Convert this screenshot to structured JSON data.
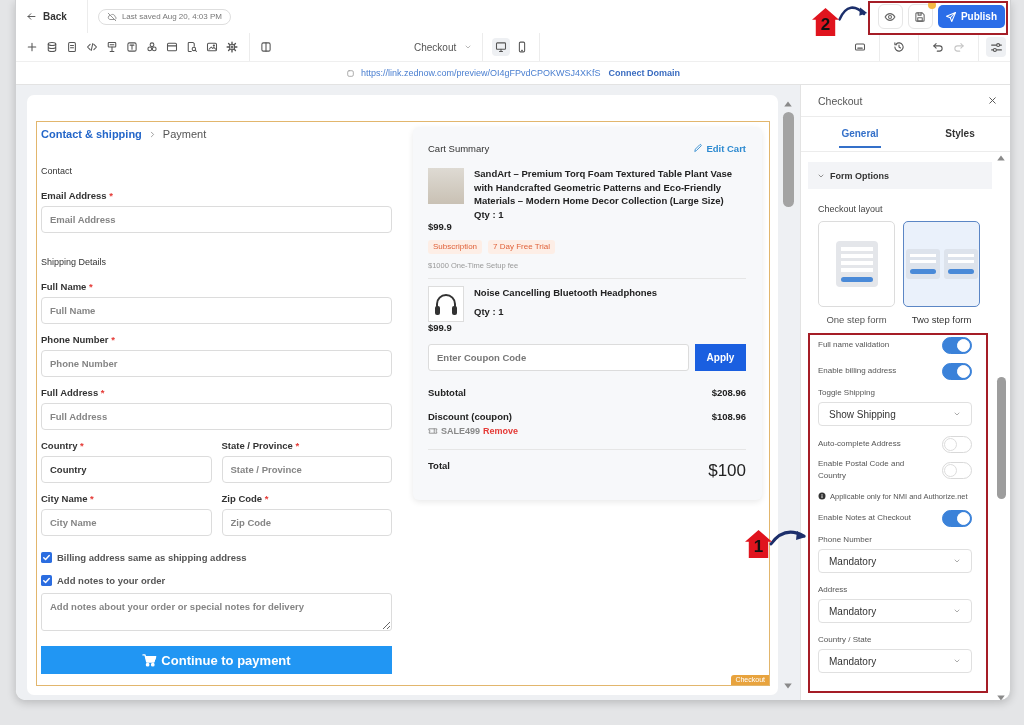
{
  "topbar": {
    "back": "Back",
    "last_saved": "Last saved Aug 20, 4:03 PM",
    "unsaved": true,
    "publish": "Publish"
  },
  "toolbar": {
    "page": "Checkout",
    "devices": [
      {
        "kind": "desktop",
        "selected": true
      },
      {
        "kind": "mobile",
        "selected": false
      }
    ],
    "history": [
      {
        "kind": "undo",
        "disabled": false
      },
      {
        "kind": "redo",
        "disabled": true
      }
    ]
  },
  "url_bar": {
    "url": "https://link.zednow.com/preview/OI4gFPvdCPOKWSJ4XKfS",
    "link": "Connect Domain"
  },
  "checkout_form": {
    "breadcrumb": [
      {
        "label": "Contact & shipping",
        "selected": true
      },
      {
        "label": "Payment",
        "selected": false
      }
    ],
    "sections": [
      {
        "heading": "Contact",
        "rows": [
          [
            {
              "label": "Email Address",
              "mark": "*",
              "placeholder": "Email Address"
            }
          ]
        ]
      },
      {
        "heading": "Shipping Details",
        "rows": [
          [
            {
              "label": "Full Name",
              "mark": "*",
              "placeholder": "Full Name"
            }
          ],
          [
            {
              "label": "Phone Number",
              "mark": "*",
              "placeholder": "Phone Number"
            }
          ],
          [
            {
              "label": "Full Address",
              "mark": "*",
              "placeholder": "Full Address"
            }
          ],
          [
            {
              "label": "Country",
              "mark": "*",
              "value": "Country"
            },
            {
              "label": "State / Province",
              "mark": "*",
              "placeholder": "State / Province"
            }
          ],
          [
            {
              "label": "City Name",
              "mark": "*",
              "placeholder": "City Name"
            },
            {
              "label": "Zip Code",
              "mark": "*",
              "placeholder": "Zip Code"
            }
          ]
        ]
      }
    ],
    "checkboxes": [
      {
        "label": "Billing address same as shipping address",
        "checked": true
      },
      {
        "label": "Add notes to your order",
        "checked": true
      }
    ],
    "notes": {
      "placeholder": "Add notes about your order or special notes for delivery"
    },
    "submit": "Continue to payment",
    "tag": "Checkout"
  },
  "cart_summary": {
    "title": "Cart Summary",
    "edit": "Edit Cart",
    "items": [
      {
        "kind": "photo",
        "name": "SandArt – Premium Torq Foam Textured Table Plant Vase with Handcrafted Geometric Patterns and Eco-Friendly Materials – Modern Home Decor Collection (Large Size)",
        "qty": "Qty : 1",
        "price": "$99.9",
        "tags": [
          "Subscription",
          "7 Day Free Trial"
        ],
        "note": "$1000 One-Time Setup fee"
      },
      {
        "kind": "headphones",
        "name": "Noise Cancelling Bluetooth Headphones",
        "qty": "Qty : 1",
        "price": "$99.9"
      }
    ],
    "coupon": {
      "placeholder": "Enter Coupon Code",
      "button": "Apply"
    },
    "totals": [
      {
        "label": "Subtotal",
        "value": "$208.96"
      },
      {
        "label": "Discount (coupon)",
        "value": "$108.96",
        "code": "SALE499",
        "action": "Remove"
      }
    ],
    "total": {
      "label": "Total",
      "value": "$100"
    }
  },
  "settings_panel": {
    "title": "Checkout",
    "tabs": [
      {
        "label": "General",
        "selected": true
      },
      {
        "label": "Styles",
        "selected": false
      }
    ],
    "section": {
      "title": "Form Options",
      "expanded": true
    },
    "layout": {
      "label": "Checkout layout",
      "options": [
        {
          "kind": "one-step",
          "label": "One step form",
          "selected": false
        },
        {
          "kind": "two-step",
          "label": "Two step form",
          "selected": true
        }
      ]
    },
    "options": [
      {
        "kind": "toggle",
        "label": "Full name validation",
        "on": true
      },
      {
        "kind": "toggle",
        "label": "Enable billing address",
        "on": true
      },
      {
        "kind": "select",
        "label": "Toggle Shipping",
        "value": "Show Shipping"
      },
      {
        "kind": "toggle",
        "label": "Auto-complete Address",
        "on": false
      },
      {
        "kind": "toggle",
        "label": "Enable Postal Code and Country",
        "on": false
      },
      {
        "kind": "note",
        "label": "Applicable only for NMI and Authorize.net"
      },
      {
        "kind": "toggle",
        "label": "Enable Notes at Checkout",
        "on": true
      },
      {
        "kind": "select",
        "label": "Phone Number",
        "value": "Mandatory"
      },
      {
        "kind": "select",
        "label": "Address",
        "value": "Mandatory"
      },
      {
        "kind": "select",
        "label": "Country / State",
        "value": "Mandatory"
      }
    ]
  },
  "annotations": [
    {
      "kind": "header-actions",
      "label": "2"
    },
    {
      "kind": "settings-list",
      "label": "1"
    }
  ]
}
